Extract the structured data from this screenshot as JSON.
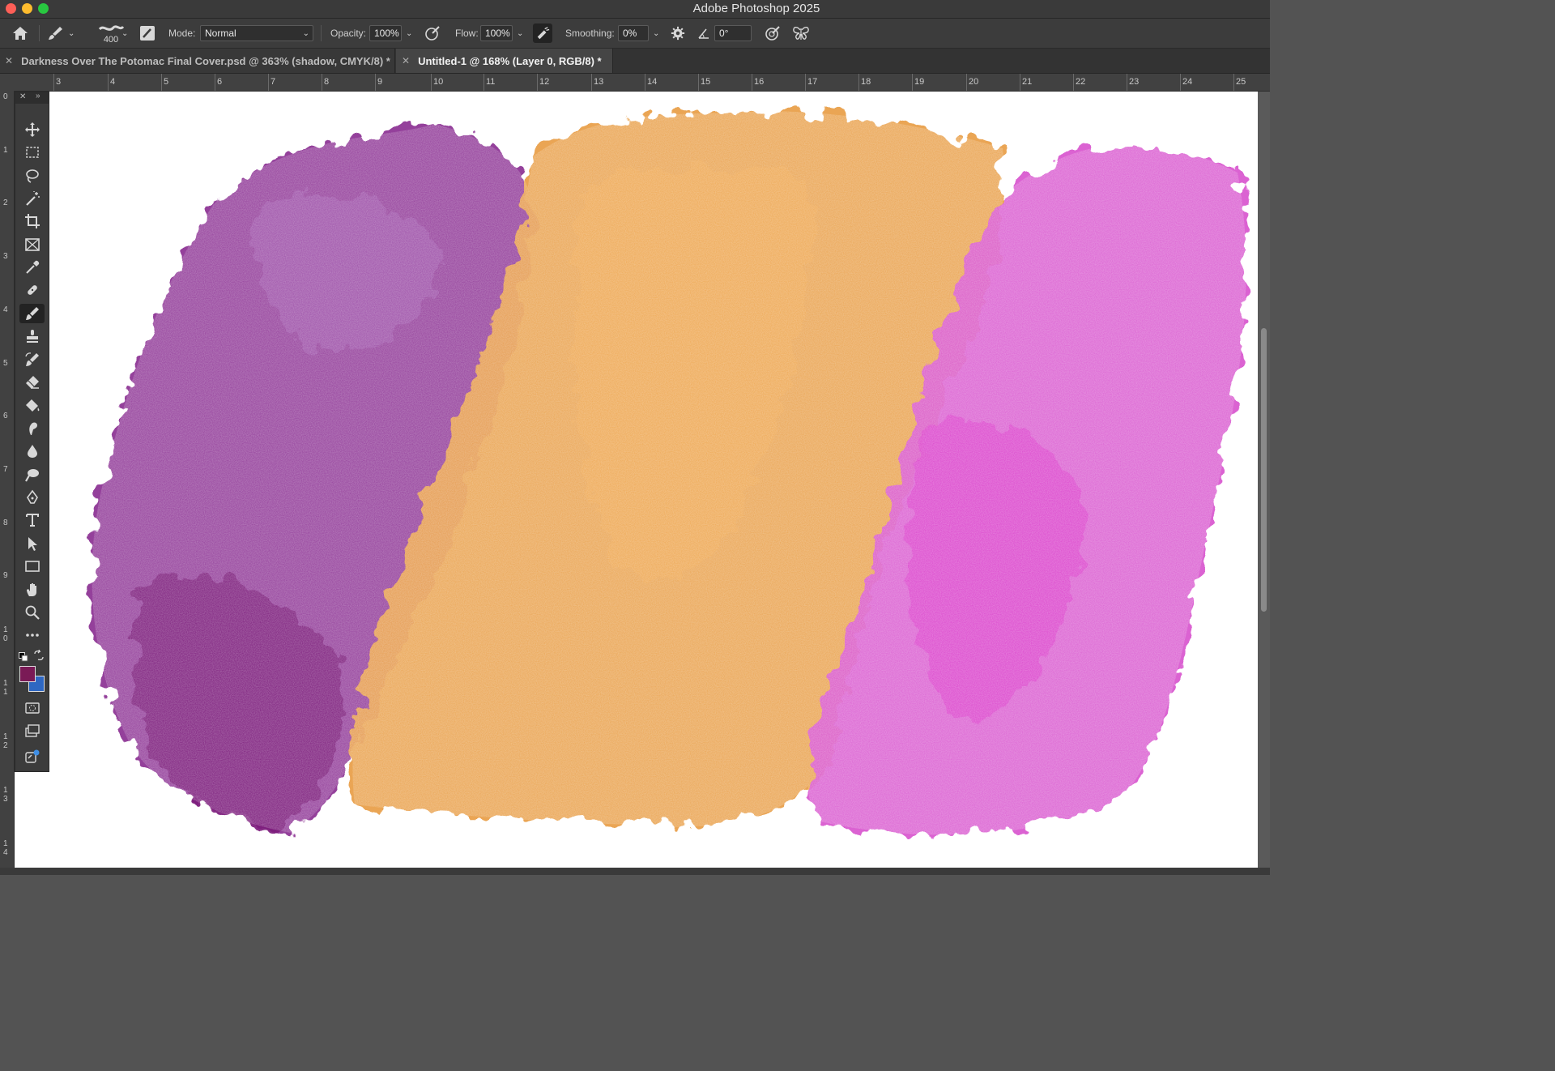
{
  "app": {
    "title": "Adobe Photoshop 2025"
  },
  "options": {
    "brush_size": "400",
    "mode_label": "Mode:",
    "mode_value": "Normal",
    "opacity_label": "Opacity:",
    "opacity_value": "100%",
    "flow_label": "Flow:",
    "flow_value": "100%",
    "smoothing_label": "Smoothing:",
    "smoothing_value": "0%",
    "angle_value": "0°"
  },
  "tabs": [
    {
      "label": "Darkness Over The Potomac Final Cover.psd @ 363% (shadow, CMYK/8) *",
      "active": false
    },
    {
      "label": "Untitled-1 @ 168% (Layer 0, RGB/8) *",
      "active": true
    }
  ],
  "ruler": {
    "top": [
      "3",
      "4",
      "5",
      "6",
      "7",
      "8",
      "9",
      "10",
      "11",
      "12",
      "13",
      "14",
      "15",
      "16",
      "17",
      "18",
      "19",
      "20",
      "21",
      "22",
      "23",
      "24",
      "25"
    ],
    "left": [
      "0",
      "1",
      "2",
      "3",
      "4",
      "5",
      "6",
      "7",
      "8",
      "9",
      "1\n0",
      "1\n1",
      "1\n2",
      "1\n3",
      "1\n4"
    ]
  },
  "colors": {
    "foreground": "#7a1a56",
    "background": "#2e67c2",
    "paint_purple": "#8a2a8e",
    "paint_orange": "#e9a04c",
    "paint_magenta": "#d855cf"
  },
  "tools": [
    "move-tool-icon",
    "marquee-tool-icon",
    "lasso-tool-icon",
    "magic-wand-icon",
    "crop-tool-icon",
    "frame-tool-icon",
    "eyedropper-icon",
    "healing-brush-icon",
    "brush-tool-icon",
    "clone-stamp-icon",
    "history-brush-icon",
    "eraser-icon",
    "paint-bucket-icon",
    "smudge-tool-icon",
    "blur-tool-icon",
    "dodge-tool-icon",
    "pen-tool-icon",
    "type-tool-icon",
    "path-selection-icon",
    "rectangle-tool-icon",
    "hand-tool-icon",
    "zoom-tool-icon",
    "more-tools-icon"
  ]
}
